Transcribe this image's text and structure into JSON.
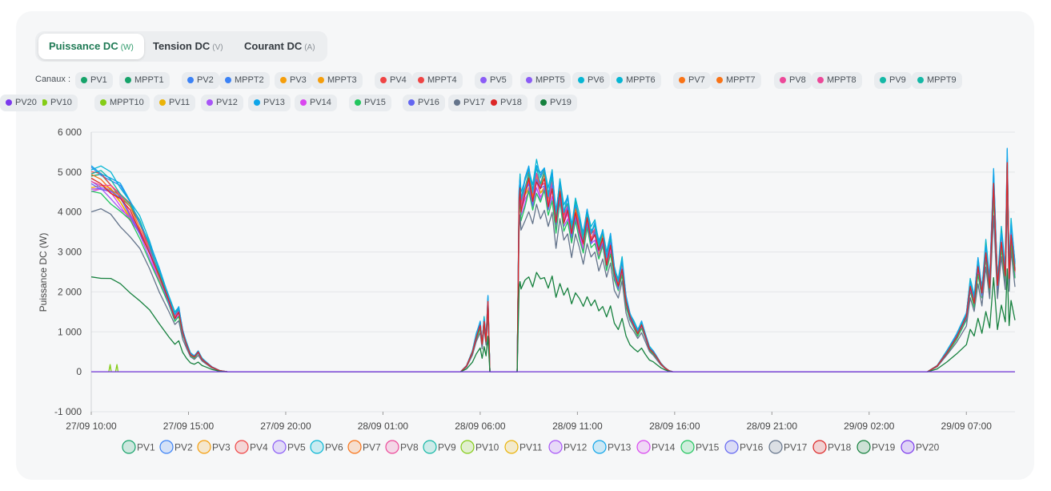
{
  "tabs": [
    {
      "label": "Puissance DC",
      "unit": "(W)",
      "active": true
    },
    {
      "label": "Tension DC",
      "unit": "(V)",
      "active": false
    },
    {
      "label": "Courant DC",
      "unit": "(A)",
      "active": false
    }
  ],
  "channels_label": "Canaux :",
  "channels": [
    {
      "label": "PV1",
      "color": "#16a36a"
    },
    {
      "label": "MPPT1",
      "color": "#16a36a"
    },
    {
      "label": "PV2",
      "color": "#3b82f6"
    },
    {
      "label": "MPPT2",
      "color": "#3b82f6"
    },
    {
      "label": "PV3",
      "color": "#f59e0b"
    },
    {
      "label": "MPPT3",
      "color": "#f59e0b"
    },
    {
      "label": "PV4",
      "color": "#ef4444"
    },
    {
      "label": "MPPT4",
      "color": "#ef4444"
    },
    {
      "label": "PV5",
      "color": "#8b5cf6"
    },
    {
      "label": "MPPT5",
      "color": "#8b5cf6"
    },
    {
      "label": "PV6",
      "color": "#06b6d4"
    },
    {
      "label": "MPPT6",
      "color": "#06b6d4"
    },
    {
      "label": "PV7",
      "color": "#f97316"
    },
    {
      "label": "MPPT7",
      "color": "#f97316"
    },
    {
      "label": "PV8",
      "color": "#ec4899"
    },
    {
      "label": "MPPT8",
      "color": "#ec4899"
    },
    {
      "label": "PV9",
      "color": "#14b8a6"
    },
    {
      "label": "MPPT9",
      "color": "#14b8a6"
    },
    {
      "label": "PV10",
      "color": "#84cc16"
    },
    {
      "label": "MPPT10",
      "color": "#84cc16"
    },
    {
      "label": "PV11",
      "color": "#eab308"
    },
    {
      "label": "PV12",
      "color": "#a855f7"
    },
    {
      "label": "PV13",
      "color": "#0ea5e9"
    },
    {
      "label": "PV14",
      "color": "#d946ef"
    },
    {
      "label": "PV15",
      "color": "#22c55e"
    },
    {
      "label": "PV16",
      "color": "#6366f1"
    },
    {
      "label": "PV17",
      "color": "#64748b"
    },
    {
      "label": "PV18",
      "color": "#dc2626"
    },
    {
      "label": "PV19",
      "color": "#15803d"
    },
    {
      "label": "PV20",
      "color": "#7c3aed"
    }
  ],
  "chart_data": {
    "type": "line",
    "ylabel": "Puissance DC (W)",
    "ylim": [
      -1000,
      6000
    ],
    "yticks": [
      -1000,
      0,
      1000,
      2000,
      3000,
      4000,
      5000,
      6000
    ],
    "ytick_labels": [
      "-1 000",
      "0",
      "1 000",
      "2 000",
      "3 000",
      "4 000",
      "5 000",
      "6 000"
    ],
    "xticks": [
      "27/09 10:00",
      "27/09 15:00",
      "27/09 20:00",
      "28/09 01:00",
      "28/09 06:00",
      "28/09 11:00",
      "28/09 16:00",
      "28/09 21:00",
      "29/09 02:00",
      "29/09 07:00"
    ],
    "x_unit": "hours since 27/09 10:00",
    "xlim": [
      0,
      47.5
    ],
    "grid": true,
    "legend_position": "bottom",
    "base_profile": {
      "x": [
        0,
        0.5,
        1,
        1.5,
        2,
        2.5,
        3,
        3.5,
        4,
        4.3,
        4.5,
        4.7,
        4.9,
        5.1,
        5.3,
        5.5,
        5.7,
        5.9,
        6.2,
        6.6,
        7,
        19,
        19.3,
        19.6,
        19.8,
        20,
        20.1,
        20.2,
        20.3,
        20.4,
        20.45,
        20.5,
        21.9,
        22.0,
        22.05,
        22.1,
        22.3,
        22.5,
        22.7,
        22.9,
        23.1,
        23.3,
        23.5,
        23.7,
        23.9,
        24.1,
        24.3,
        24.5,
        24.7,
        24.9,
        25.1,
        25.3,
        25.5,
        25.7,
        25.9,
        26.1,
        26.3,
        26.5,
        26.7,
        26.9,
        27.1,
        27.3,
        27.5,
        27.7,
        27.9,
        28.1,
        28.3,
        28.5,
        28.7,
        28.9,
        29.1,
        29.3,
        29.5,
        29.7,
        29.9,
        30.1,
        30.3,
        30.5,
        30.7,
        31,
        31.5,
        43,
        43.5,
        44,
        44.5,
        45,
        45.2,
        45.4,
        45.6,
        45.8,
        46.0,
        46.2,
        46.4,
        46.6,
        46.8,
        47.0,
        47.1,
        47.2,
        47.3,
        47.5
      ],
      "y": [
        4900,
        4850,
        4700,
        4450,
        4100,
        3650,
        3100,
        2450,
        1800,
        1400,
        1550,
        1000,
        700,
        450,
        380,
        500,
        320,
        240,
        120,
        30,
        0,
        0,
        150,
        500,
        900,
        1200,
        700,
        1300,
        800,
        1800,
        900,
        0,
        0,
        4300,
        4700,
        4200,
        4600,
        4900,
        4400,
        5000,
        4700,
        4900,
        4300,
        4800,
        3800,
        4600,
        3900,
        4200,
        3500,
        4100,
        3700,
        3300,
        3900,
        3400,
        3600,
        3100,
        3400,
        2800,
        3300,
        2500,
        2200,
        2700,
        1800,
        1400,
        1200,
        1000,
        1200,
        900,
        600,
        500,
        350,
        200,
        100,
        30,
        0,
        0,
        0,
        0,
        0,
        0,
        0,
        0,
        150,
        500,
        900,
        1400,
        2200,
        1800,
        2700,
        2000,
        3100,
        2200,
        4800,
        2200,
        3400,
        2500,
        5300,
        2400,
        3600,
        2600
      ]
    },
    "series": [
      {
        "name": "PV1",
        "color": "#16a36a",
        "scale": 1.0
      },
      {
        "name": "PV2",
        "color": "#3b82f6",
        "scale": 1.03
      },
      {
        "name": "PV3",
        "color": "#f59e0b",
        "scale": 0.96
      },
      {
        "name": "PV4",
        "color": "#ef4444",
        "scale": 1.01
      },
      {
        "name": "PV5",
        "color": "#8b5cf6",
        "scale": 0.97
      },
      {
        "name": "PV6",
        "color": "#06b6d4",
        "scale": 1.05
      },
      {
        "name": "PV7",
        "color": "#f97316",
        "scale": 0.99
      },
      {
        "name": "PV8",
        "color": "#ec4899",
        "scale": 0.98
      },
      {
        "name": "PV9",
        "color": "#14b8a6",
        "scale": 1.02
      },
      {
        "name": "PV10",
        "color": "#84cc16",
        "scale": 0.0
      },
      {
        "name": "PV11",
        "color": "#eab308",
        "scale": 0.95
      },
      {
        "name": "PV12",
        "color": "#a855f7",
        "scale": 0.93
      },
      {
        "name": "PV13",
        "color": "#0ea5e9",
        "scale": 1.04
      },
      {
        "name": "PV14",
        "color": "#d946ef",
        "scale": 0.94
      },
      {
        "name": "PV15",
        "color": "#22c55e",
        "scale": 0.91
      },
      {
        "name": "PV16",
        "color": "#6366f1",
        "scale": 0.96
      },
      {
        "name": "PV17",
        "color": "#64748b",
        "scale": 0.83
      },
      {
        "name": "PV18",
        "color": "#dc2626",
        "scale": 0.97
      },
      {
        "name": "PV19",
        "color": "#15803d",
        "scale": 0.49
      },
      {
        "name": "PV20",
        "color": "#7c3aed",
        "scale": 0.0
      }
    ]
  }
}
